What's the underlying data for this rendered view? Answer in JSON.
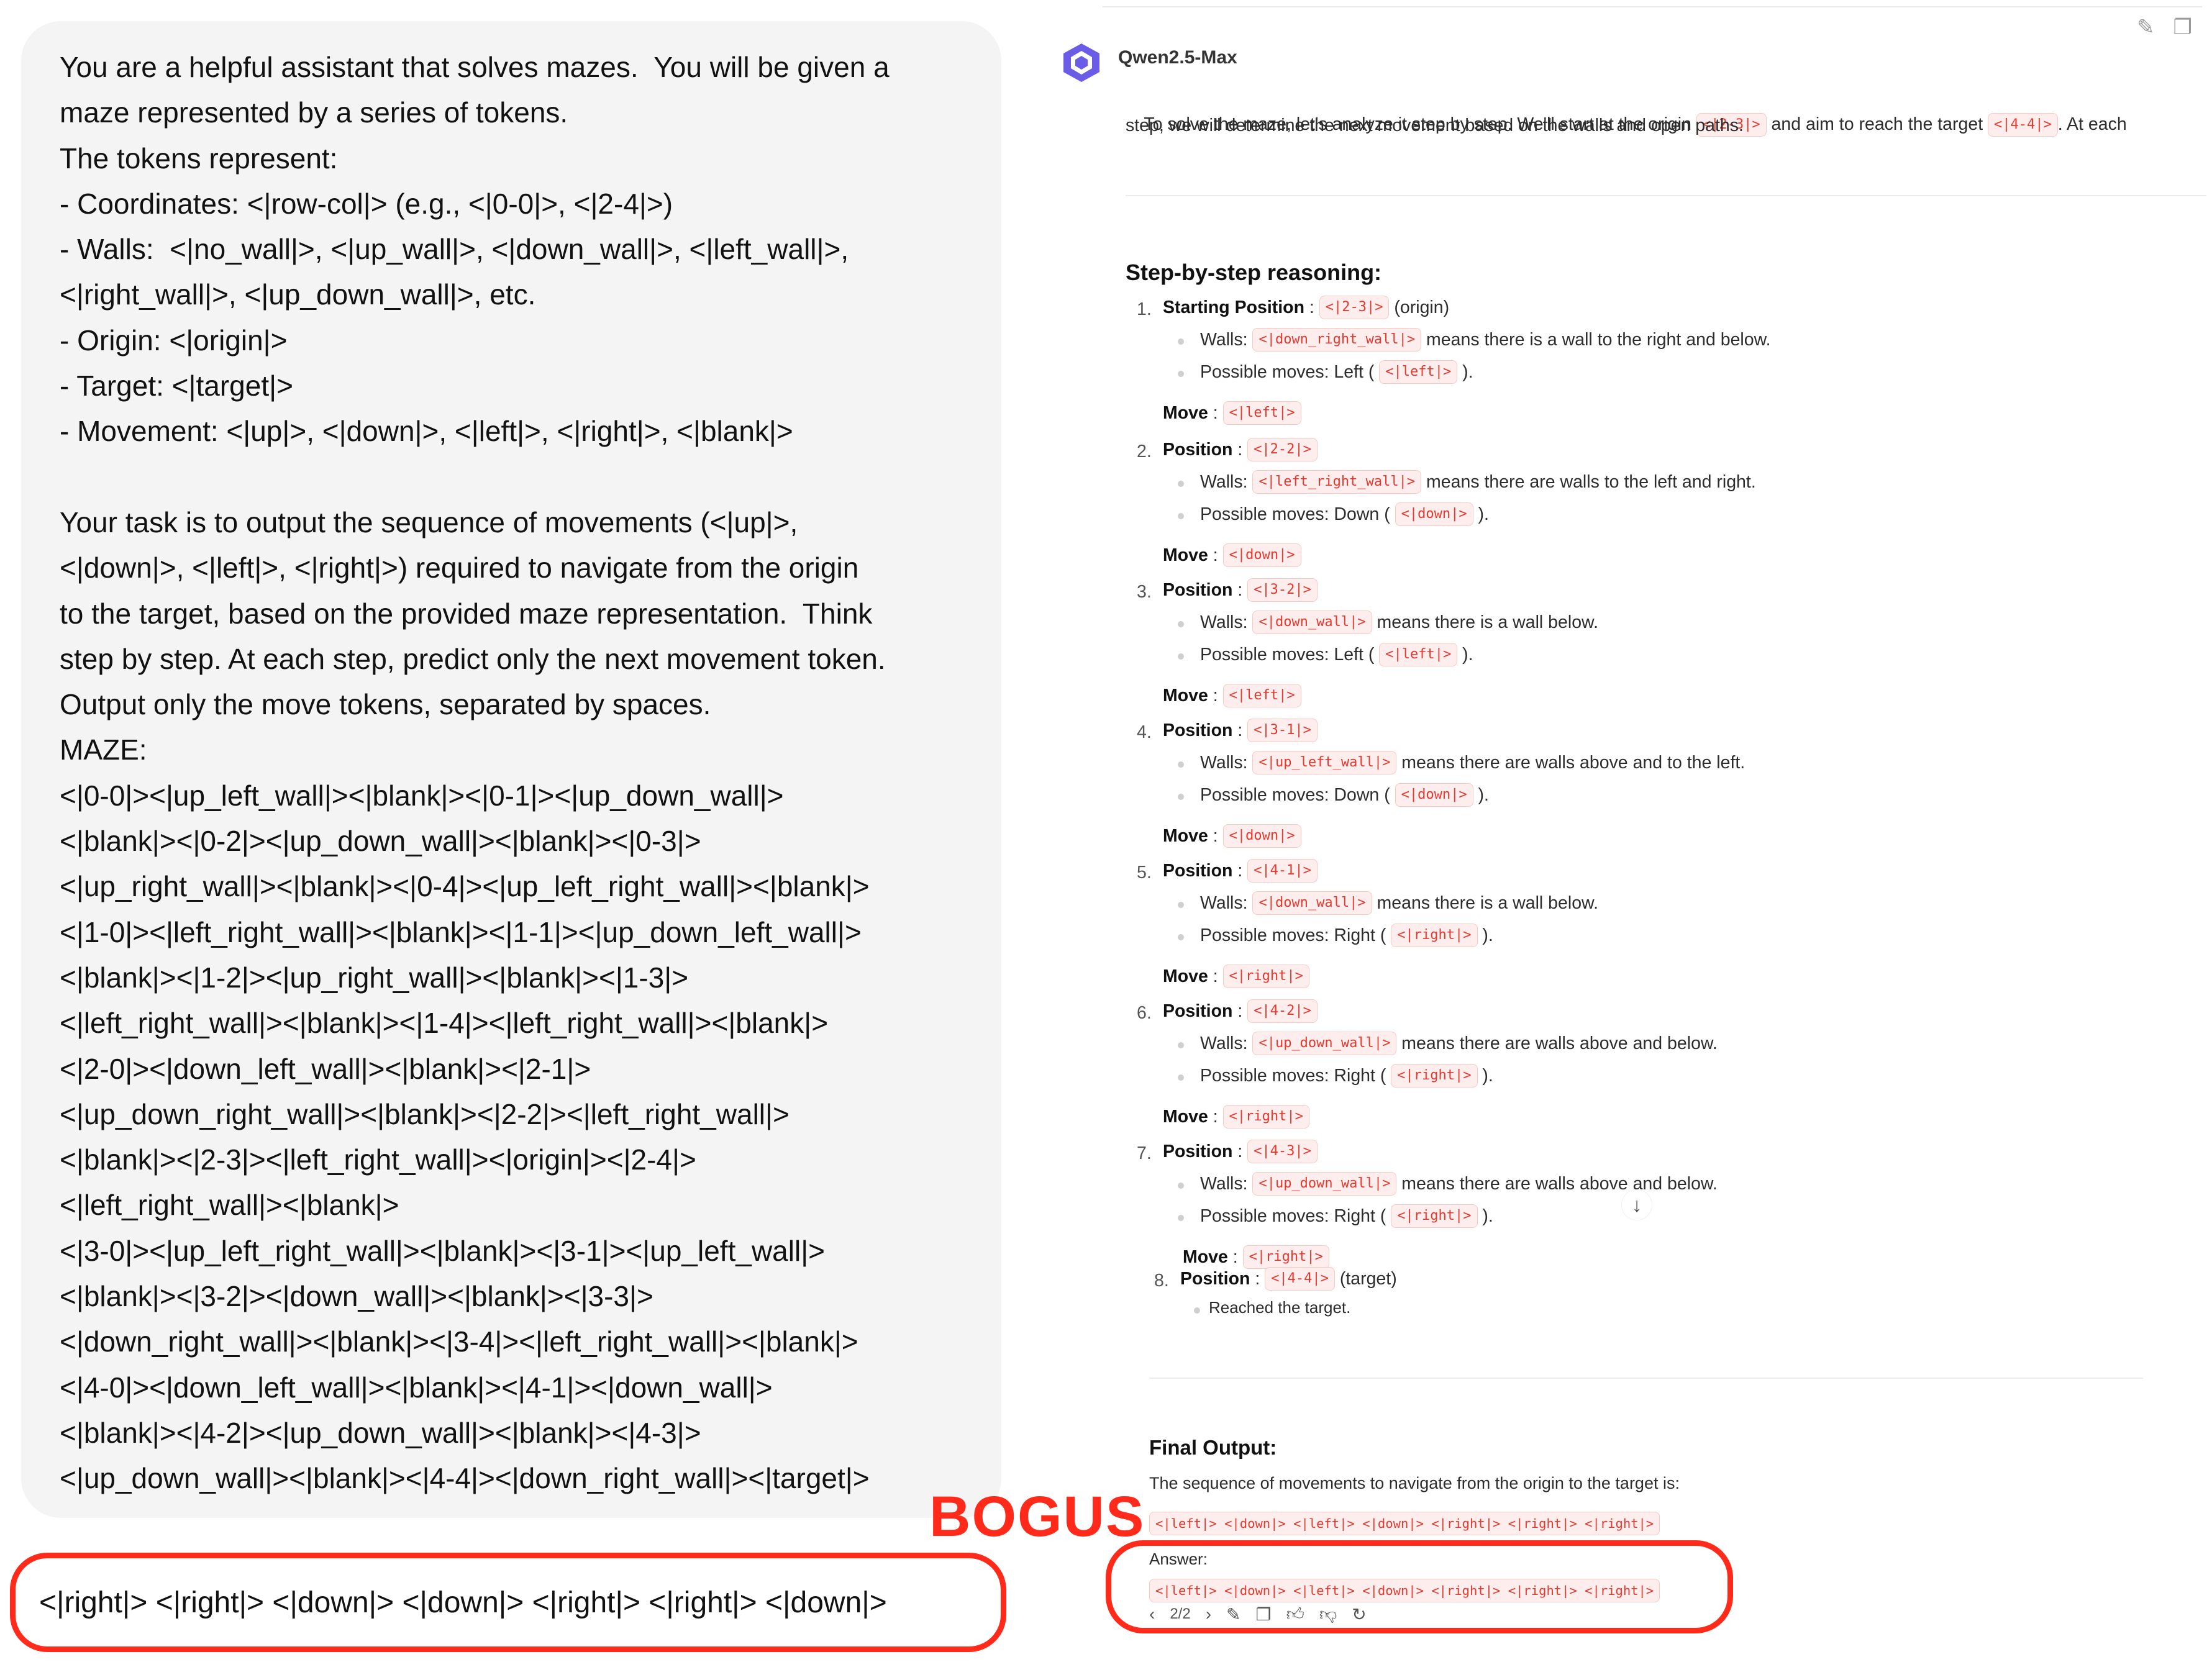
{
  "prompt": {
    "lines": [
      "You are a helpful assistant that solves mazes.  You will be given a",
      "maze represented by a series of tokens.",
      "The tokens represent:",
      "- Coordinates: <|row-col|> (e.g., <|0-0|>, <|2-4|>)",
      "- Walls:  <|no_wall|>, <|up_wall|>, <|down_wall|>, <|left_wall|>,",
      "<|right_wall|>, <|up_down_wall|>, etc.",
      "- Origin: <|origin|>",
      "- Target: <|target|>",
      "- Movement: <|up|>, <|down|>, <|left|>, <|right|>, <|blank|>",
      "",
      "Your task is to output the sequence of movements (<|up|>,",
      "<|down|>, <|left|>, <|right|>) required to navigate from the origin",
      "to the target, based on the provided maze representation.  Think",
      "step by step. At each step, predict only the next movement token.",
      "Output only the move tokens, separated by spaces.",
      "MAZE:",
      "<|0-0|><|up_left_wall|><|blank|><|0-1|><|up_down_wall|>",
      "<|blank|><|0-2|><|up_down_wall|><|blank|><|0-3|>",
      "<|up_right_wall|><|blank|><|0-4|><|up_left_right_wall|><|blank|>",
      "<|1-0|><|left_right_wall|><|blank|><|1-1|><|up_down_left_wall|>",
      "<|blank|><|1-2|><|up_right_wall|><|blank|><|1-3|>",
      "<|left_right_wall|><|blank|><|1-4|><|left_right_wall|><|blank|>",
      "<|2-0|><|down_left_wall|><|blank|><|2-1|>",
      "<|up_down_right_wall|><|blank|><|2-2|><|left_right_wall|>",
      "<|blank|><|2-3|><|left_right_wall|><|origin|><|2-4|>",
      "<|left_right_wall|><|blank|>",
      "<|3-0|><|up_left_right_wall|><|blank|><|3-1|><|up_left_wall|>",
      "<|blank|><|3-2|><|down_wall|><|blank|><|3-3|>",
      "<|down_right_wall|><|blank|><|3-4|><|left_right_wall|><|blank|>",
      "<|4-0|><|down_left_wall|><|blank|><|4-1|><|down_wall|>",
      "<|blank|><|4-2|><|up_down_wall|><|blank|><|4-3|>",
      "<|up_down_wall|><|blank|><|4-4|><|down_right_wall|><|target|>"
    ]
  },
  "human_answer": "<|right|> <|right|> <|down|> <|down|> <|right|> <|right|> <|down|>",
  "bogus_label": "BOGUS",
  "model": {
    "name": "Qwen2.5-Max",
    "intro_a": "To solve the maze, let's analyze it step by step. We'll start at the origin ",
    "intro_tok1": "<|2-3|>",
    "intro_b": " and aim to reach the target ",
    "intro_tok2": "<|4-4|>",
    "intro_c": ". At each",
    "intro_line2": "step, we will determine the next movement based on the walls and open paths.",
    "section_title": "Step-by-step reasoning:",
    "steps": [
      {
        "num": "1.",
        "head": "Starting Position",
        "tok": "<|2-3|>",
        "suffix": " (origin)",
        "walls_label": "Walls: ",
        "walls_tok": "<|down_right_wall|>",
        "walls_text": " means there is a wall to the right and below.",
        "moves_label": "Possible moves: Left ( ",
        "moves_tok": "<|left|>",
        "moves_end": " ).",
        "move_label": "Move",
        "move_tok": "<|left|>"
      },
      {
        "num": "2.",
        "head": "Position",
        "tok": "<|2-2|>",
        "suffix": "",
        "walls_label": "Walls: ",
        "walls_tok": "<|left_right_wall|>",
        "walls_text": " means there are walls to the left and right.",
        "moves_label": "Possible moves: Down ( ",
        "moves_tok": "<|down|>",
        "moves_end": " ).",
        "move_label": "Move",
        "move_tok": "<|down|>"
      },
      {
        "num": "3.",
        "head": "Position",
        "tok": "<|3-2|>",
        "suffix": "",
        "walls_label": "Walls: ",
        "walls_tok": "<|down_wall|>",
        "walls_text": " means there is a wall below.",
        "moves_label": "Possible moves: Left ( ",
        "moves_tok": "<|left|>",
        "moves_end": " ).",
        "move_label": "Move",
        "move_tok": "<|left|>"
      },
      {
        "num": "4.",
        "head": "Position",
        "tok": "<|3-1|>",
        "suffix": "",
        "walls_label": "Walls: ",
        "walls_tok": "<|up_left_wall|>",
        "walls_text": " means there are walls above and to the left.",
        "moves_label": "Possible moves: Down ( ",
        "moves_tok": "<|down|>",
        "moves_end": " ).",
        "move_label": "Move",
        "move_tok": "<|down|>"
      },
      {
        "num": "5.",
        "head": "Position",
        "tok": "<|4-1|>",
        "suffix": "",
        "walls_label": "Walls: ",
        "walls_tok": "<|down_wall|>",
        "walls_text": " means there is a wall below.",
        "moves_label": "Possible moves: Right ( ",
        "moves_tok": "<|right|>",
        "moves_end": " ).",
        "move_label": "Move",
        "move_tok": "<|right|>"
      },
      {
        "num": "6.",
        "head": "Position",
        "tok": "<|4-2|>",
        "suffix": "",
        "walls_label": "Walls: ",
        "walls_tok": "<|up_down_wall|>",
        "walls_text": " means there are walls above and below.",
        "moves_label": "Possible moves: Right ( ",
        "moves_tok": "<|right|>",
        "moves_end": " ).",
        "move_label": "Move",
        "move_tok": "<|right|>"
      },
      {
        "num": "7.",
        "head": "Position",
        "tok": "<|4-3|>",
        "suffix": "",
        "walls_label": "Walls: ",
        "walls_tok": "<|up_down_wall|>",
        "walls_text": " means there are walls above and below.",
        "moves_label": "Possible moves: Right ( ",
        "moves_tok": "<|right|>",
        "moves_end": " ).",
        "move_label": "Move",
        "move_tok": "<|right|>"
      }
    ],
    "step8": {
      "num": "8.",
      "head": "Position",
      "tok": "<|4-4|>",
      "suffix": " (target)",
      "bullet": "Reached the target."
    },
    "final_title": "Final Output:",
    "final_text": "The sequence of movements to navigate from the origin to the target is:",
    "final_seq": "<|left|> <|down|> <|left|> <|down|> <|right|> <|right|> <|right|>",
    "answer_label": "Answer:",
    "answer_seq": "<|left|> <|down|> <|left|> <|down|> <|right|> <|right|> <|right|>",
    "pager": "2/2",
    "icons": [
      "chevron-left-icon",
      "chevron-right-icon",
      "edit-icon",
      "copy-icon",
      "thumbs-up-icon",
      "thumbs-down-icon",
      "regenerate-icon"
    ]
  },
  "colors": {
    "accent_red": "#ff2a1a",
    "token_red": "#e5392f",
    "bubble_bg": "#f4f4f4"
  }
}
